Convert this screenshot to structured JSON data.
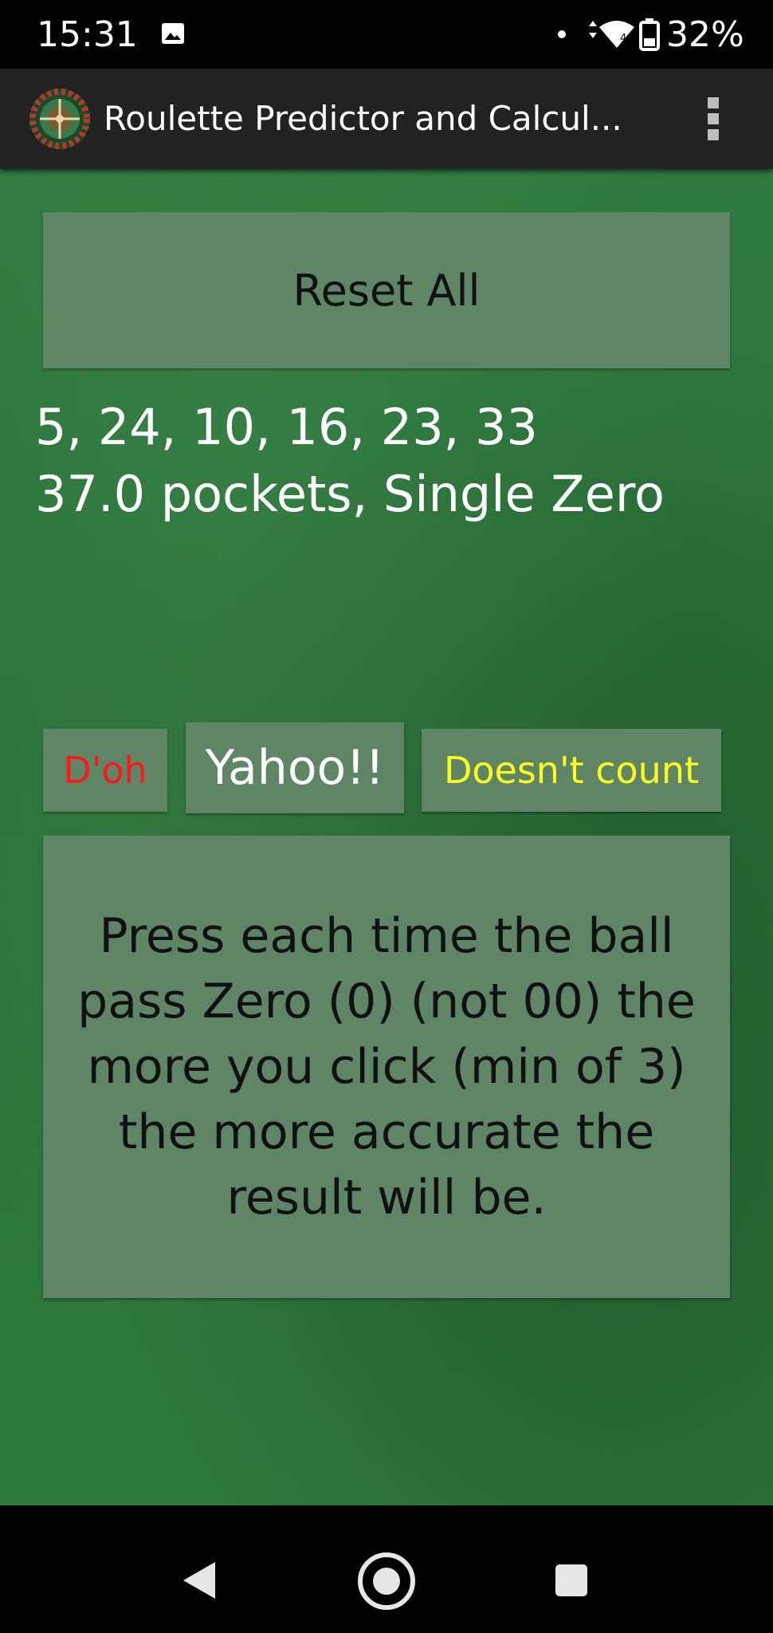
{
  "status_bar": {
    "time": "15:31",
    "battery": "32%",
    "icons": [
      "gallery-icon",
      "dot-icon",
      "data-arrows-icon",
      "wifi-icon",
      "battery-icon"
    ]
  },
  "app_bar": {
    "title": "Roulette Predictor and Calcul...",
    "logo_icon": "roulette-wheel-icon",
    "menu_icon": "more-vert-icon"
  },
  "main": {
    "reset_label": "Reset All",
    "numbers_text": "5, 24, 10, 16, 23, 33",
    "pockets_text": "37.0 pockets,  Single Zero",
    "buttons": {
      "doh_label": "D'oh",
      "yahoo_label": "Yahoo!!",
      "doesnt_count_label": "Doesn't count"
    },
    "instructions_text": "Press each time the ball pass Zero (0) (not 00) the more you click (min of 3) the more accurate the result will be."
  },
  "colors": {
    "felt_green": "#2d7a3c",
    "button_gray_green": "#5e8566",
    "doh_red": "#ff1a1a",
    "doesnt_count_yellow": "#ffff1f",
    "app_bar": "#222222"
  },
  "nav_bar": {
    "icons": [
      "back-icon",
      "home-icon",
      "recents-icon"
    ]
  }
}
